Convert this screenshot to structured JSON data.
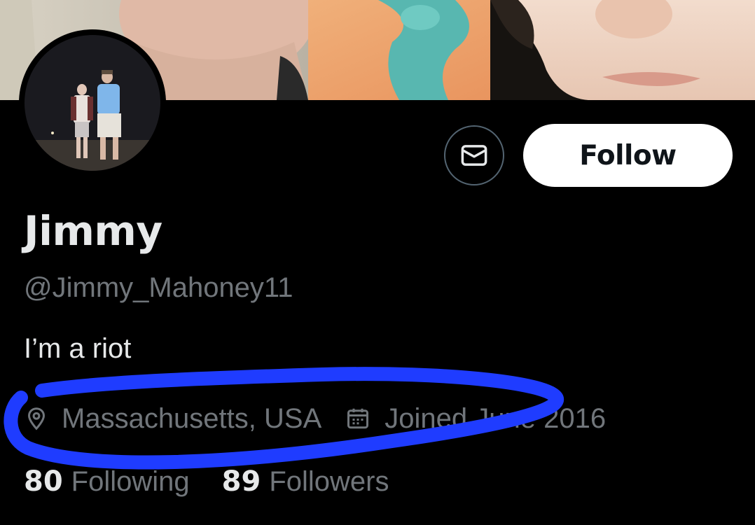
{
  "profile": {
    "display_name": "Jimmy",
    "handle": "@Jimmy_Mahoney11",
    "bio": "I’m a riot",
    "location": "Massachusetts, USA",
    "joined": "Joined June 2016"
  },
  "actions": {
    "follow_label": "Follow",
    "message_icon": "envelope-icon"
  },
  "stats": {
    "following_count": "80",
    "following_label": "Following",
    "followers_count": "89",
    "followers_label": "Followers"
  },
  "icons": {
    "location": "map-pin-icon",
    "joined": "calendar-icon"
  },
  "colors": {
    "background": "#000000",
    "primary_text": "#e7e9ea",
    "secondary_text": "#71767b",
    "annotation": "#1f3cff"
  }
}
